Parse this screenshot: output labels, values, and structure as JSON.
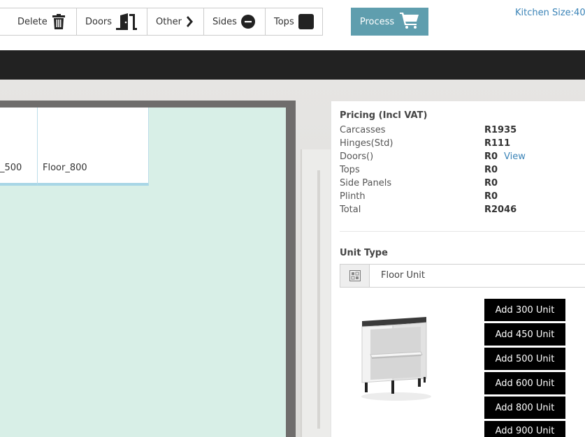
{
  "toolbar": {
    "delete_label": "Delete",
    "doors_label": "Doors",
    "other_label": "Other",
    "sides_label": "Sides",
    "tops_label": "Tops",
    "process_label": "Process",
    "kitchen_size": "Kitchen Size:40"
  },
  "plan": {
    "units": [
      "_500",
      "Floor_800"
    ]
  },
  "pricing": {
    "title": "Pricing (Incl VAT)",
    "rows": [
      {
        "label": "Carcasses",
        "value": "R1935"
      },
      {
        "label": "Hinges(Std)",
        "value": "R111"
      },
      {
        "label": "Doors()",
        "value": "R0",
        "link": "View"
      },
      {
        "label": "Tops",
        "value": "R0"
      },
      {
        "label": "Side Panels",
        "value": "R0"
      },
      {
        "label": "Plinth",
        "value": "R0"
      },
      {
        "label": "Total",
        "value": "R2046"
      }
    ]
  },
  "unit_type": {
    "label": "Unit Type",
    "selected": "Floor Unit"
  },
  "add_buttons": [
    "Add 300 Unit",
    "Add 450 Unit",
    "Add 500 Unit",
    "Add 600 Unit",
    "Add 800 Unit",
    "Add 900 Unit"
  ]
}
